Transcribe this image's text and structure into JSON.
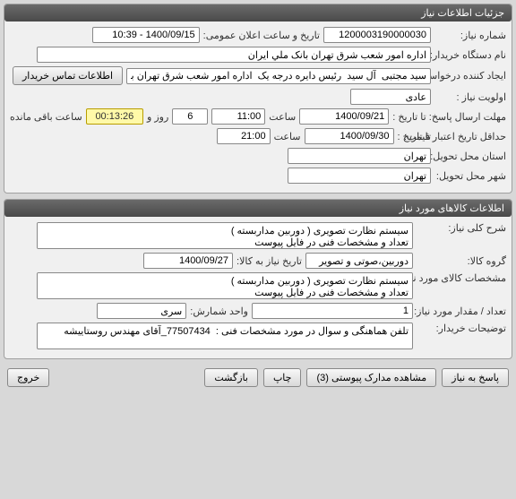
{
  "panel1": {
    "title": "جزئیات اطلاعات نیاز",
    "need_no_label": "شماره نیاز:",
    "need_no": "1200003190000030",
    "announce_label": "تاریخ و ساعت اعلان عمومی:",
    "announce_value": "1400/09/15 - 10:39",
    "buyer_label": "نام دستگاه خریدار:",
    "buyer_value": "اداره امور شعب شرق تهران بانک ملي ایران",
    "creator_label": "ایجاد کننده درخواست:",
    "creator_value": "سید مجتبی  آل سید  رئیس دایره درجه یک  اداره امور شعب شرق تهران بانک م",
    "contact_btn": "اطلاعات تماس خریدار",
    "priority_label": "اولویت نیاز :",
    "priority_value": "عادی",
    "deadline_label": "مهلت ارسال پاسخ: تا تاریخ :",
    "deadline_date": "1400/09/21",
    "time_label": "ساعت",
    "deadline_time": "11:00",
    "days_value": "6",
    "days_label": "روز و",
    "timer": "00:13:26",
    "timer_suffix": "ساعت باقی مانده",
    "min_valid_label": "حداقل تاریخ اعتبار قیمت:",
    "min_valid_to": "تا تاریخ :",
    "min_valid_date": "1400/09/30",
    "min_valid_time": "21:00",
    "province_label": "استان محل تحویل:",
    "province_value": "تهران",
    "city_label": "شهر محل تحویل:",
    "city_value": "تهران"
  },
  "panel2": {
    "title": "اطلاعات کالاهای مورد نیاز",
    "overall_desc_label": "شرح کلی نیاز:",
    "overall_desc": "سیستم نظارت تصویری ( دوربین مداربسته )\nتعداد و مشخصات فنی در فایل پیوست",
    "group_label": "گروه کالا:",
    "group_value": "دوربین،صوتی و تصویر",
    "need_date_label": "تاریخ نیاز به کالا:",
    "need_date": "1400/09/27",
    "spec_label": "مشخصات کالای مورد نیاز:",
    "spec_value": "سیستم نظارت تصویری ( دوربین مداربسته )\nتعداد و مشخصات فنی در فایل پیوست",
    "qty_label": "تعداد / مقدار مورد نیاز:",
    "qty_value": "1",
    "unit_label": "واحد شمارش:",
    "unit_value": "سری",
    "notes_label": "توضیحات خریدار:",
    "notes_value": "تلفن هماهنگی و سوال در مورد مشخصات فنی :  77507434_آقای مهندس روستاییشه"
  },
  "buttons": {
    "reply": "پاسخ به نیاز",
    "attachments": "مشاهده مدارک پیوستی (3)",
    "print": "چاپ",
    "back": "بازگشت",
    "exit": "خروج"
  }
}
